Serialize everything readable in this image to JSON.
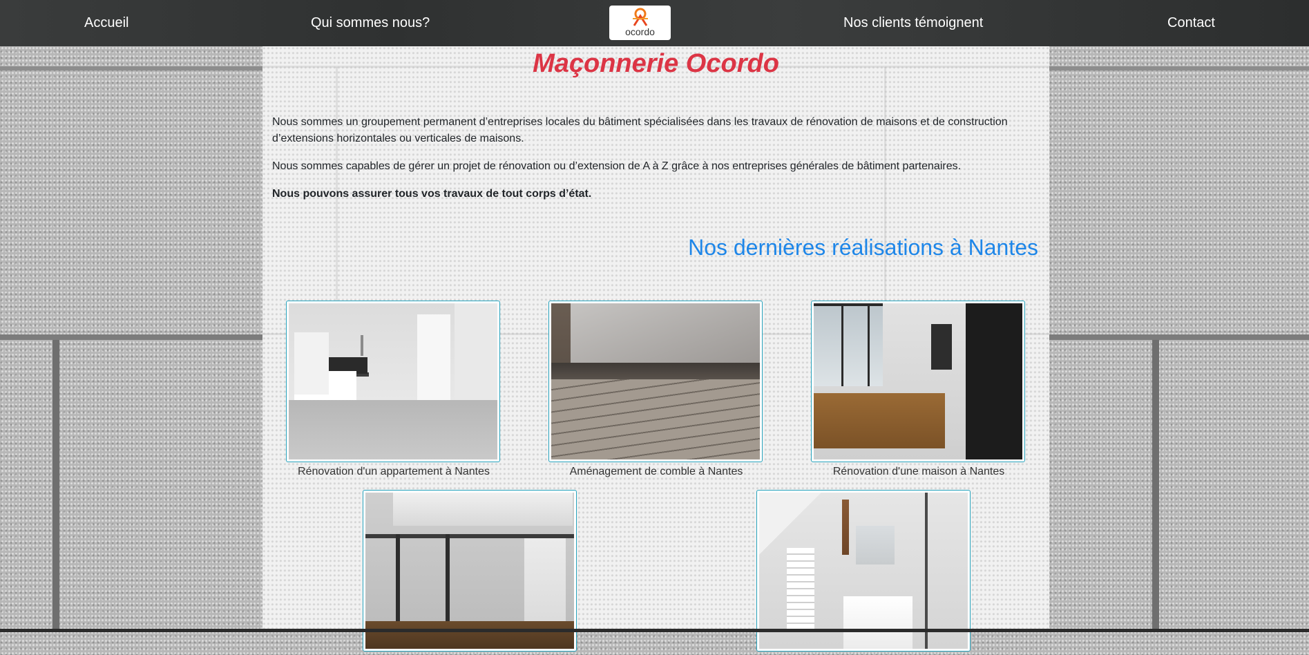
{
  "nav": {
    "items": [
      {
        "label": "Accueil"
      },
      {
        "label": "Qui sommes nous?"
      },
      {
        "label": "Nos clients témoignent"
      },
      {
        "label": "Contact"
      }
    ],
    "logo_text": "ocordo"
  },
  "main": {
    "title": "Maçonnerie Ocordo",
    "paragraphs": [
      "Nous sommes un groupement permanent d’entreprises locales du bâtiment spécialisées dans les travaux de rénovation de maisons et de construction d’extensions horizontales ou verticales de maisons.",
      "Nous sommes capables de gérer un projet de rénovation ou d’extension de A à Z grâce à nos entreprises générales de bâtiment partenaires.",
      "Nous pouvons assurer tous vos travaux de tout corps d’état."
    ],
    "section_title": "Nos dernières réalisations à Nantes"
  },
  "gallery": [
    {
      "caption": "Rénovation d'un appartement à Nantes"
    },
    {
      "caption": "Aménagement de comble à Nantes"
    },
    {
      "caption": "Rénovation d'une maison à Nantes"
    },
    {
      "caption": ""
    },
    {
      "caption": ""
    }
  ],
  "colors": {
    "title": "#dc3545",
    "section_title": "#1e86e8",
    "frame_border": "#26a3bd",
    "navbar": "#343636"
  }
}
